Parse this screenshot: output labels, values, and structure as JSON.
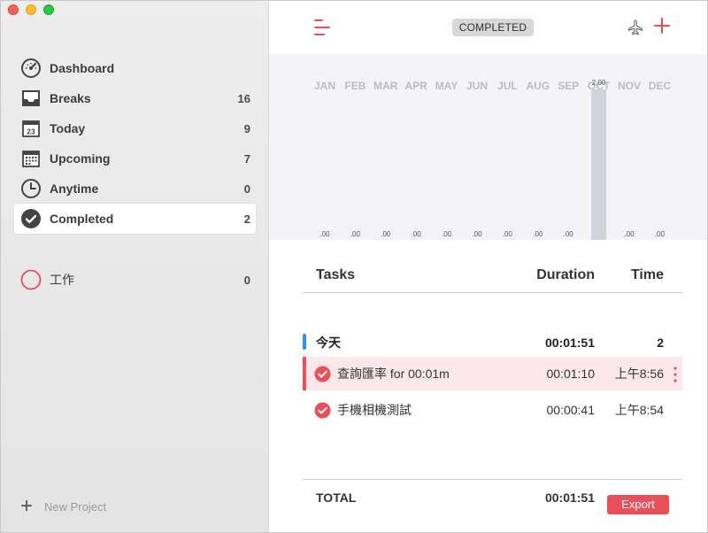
{
  "sidebar": {
    "items": [
      {
        "label": "Dashboard",
        "count": "",
        "icon": "dashboard-icon"
      },
      {
        "label": "Breaks",
        "count": "16",
        "icon": "tray-icon"
      },
      {
        "label": "Today",
        "count": "9",
        "icon": "calendar-today-icon"
      },
      {
        "label": "Upcoming",
        "count": "7",
        "icon": "calendar-grid-icon"
      },
      {
        "label": "Anytime",
        "count": "0",
        "icon": "clock-icon"
      },
      {
        "label": "Completed",
        "count": "2",
        "icon": "check-circle-icon"
      }
    ],
    "today_icon_number": "23",
    "project": {
      "label": "工作",
      "count": "0",
      "color": "#e8515c"
    },
    "new_project_label": "New Project"
  },
  "toolbar": {
    "status": "COMPLETED"
  },
  "chart_data": {
    "type": "bar",
    "categories": [
      "JAN",
      "FEB",
      "MAR",
      "APR",
      "MAY",
      "JUN",
      "JUL",
      "AUG",
      "SEP",
      "OCT",
      "NOV",
      "DEC"
    ],
    "values": [
      0,
      0,
      0,
      0,
      0,
      0,
      0,
      0,
      0,
      2,
      0,
      0
    ],
    "value_labels": [
      ".00",
      ".00",
      ".00",
      ".00",
      ".00",
      ".00",
      ".00",
      ".00",
      ".00",
      "2.00",
      ".00",
      ".00"
    ],
    "ylim": [
      0,
      2.4
    ],
    "bar_color": "#d0d3db",
    "title": "",
    "xlabel": "",
    "ylabel": ""
  },
  "table": {
    "headers": {
      "task": "Tasks",
      "duration": "Duration",
      "time": "Time"
    },
    "group": {
      "name": "今天",
      "duration": "00:01:51",
      "count": "2"
    },
    "rows": [
      {
        "name": "查詢匯率 for 00:01m",
        "duration": "00:01:10",
        "time": "上午8:56",
        "selected": true
      },
      {
        "name": "手機相機測試",
        "duration": "00:00:41",
        "time": "上午8:54",
        "selected": false
      }
    ],
    "total_label": "TOTAL",
    "total_duration": "00:01:51",
    "export_label": "Export"
  },
  "colors": {
    "accent": "#e8515c",
    "group_bar": "#3a8ee6"
  }
}
